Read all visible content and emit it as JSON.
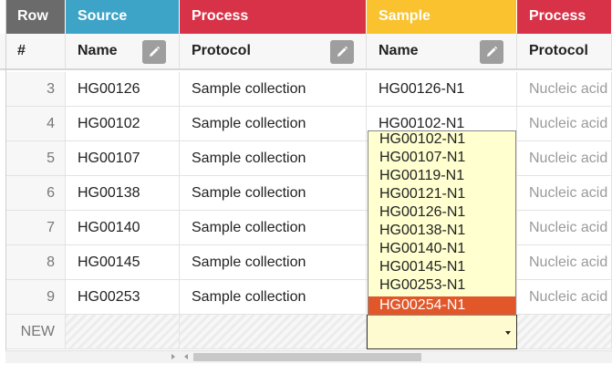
{
  "colors": {
    "row": "#6b6b6b",
    "source": "#3ea4c7",
    "process": "#d83248",
    "sample": "#f9c22e",
    "dropdown_selected": "#e1572a",
    "editor_bg": "#fffbd0"
  },
  "categories": {
    "row": "Row",
    "source": "Source",
    "process": "Process",
    "sample": "Sample",
    "process2": "Process"
  },
  "headers": {
    "num": "#",
    "source_name": "Name",
    "protocol": "Protocol",
    "sample_name": "Name",
    "protocol2": "Protocol"
  },
  "icons": {
    "edit": "pencil-icon",
    "dropdown": "caret-down-icon",
    "scroll_left": "arrow-left-icon",
    "scroll_right": "arrow-right-icon"
  },
  "rows": [
    {
      "num": "3",
      "source": "HG00126",
      "protocol": "Sample collection",
      "sample": "HG00126-N1",
      "protocol2": "Nucleic acid"
    },
    {
      "num": "4",
      "source": "HG00102",
      "protocol": "Sample collection",
      "sample": "HG00102-N1",
      "protocol2": "Nucleic acid"
    },
    {
      "num": "5",
      "source": "HG00107",
      "protocol": "Sample collection",
      "sample": "",
      "protocol2": "Nucleic acid"
    },
    {
      "num": "6",
      "source": "HG00138",
      "protocol": "Sample collection",
      "sample": "",
      "protocol2": "Nucleic acid"
    },
    {
      "num": "7",
      "source": "HG00140",
      "protocol": "Sample collection",
      "sample": "",
      "protocol2": "Nucleic acid"
    },
    {
      "num": "8",
      "source": "HG00145",
      "protocol": "Sample collection",
      "sample": "",
      "protocol2": "Nucleic acid"
    },
    {
      "num": "9",
      "source": "HG00253",
      "protocol": "Sample collection",
      "sample": "",
      "protocol2": "Nucleic acid"
    }
  ],
  "new_row": {
    "label": "NEW",
    "editor_value": ""
  },
  "dropdown": {
    "options": [
      "HG00102-N1",
      "HG00107-N1",
      "HG00119-N1",
      "HG00121-N1",
      "HG00126-N1",
      "HG00138-N1",
      "HG00140-N1",
      "HG00145-N1",
      "HG00253-N1",
      "HG00254-N1"
    ],
    "selected_index": 9
  }
}
